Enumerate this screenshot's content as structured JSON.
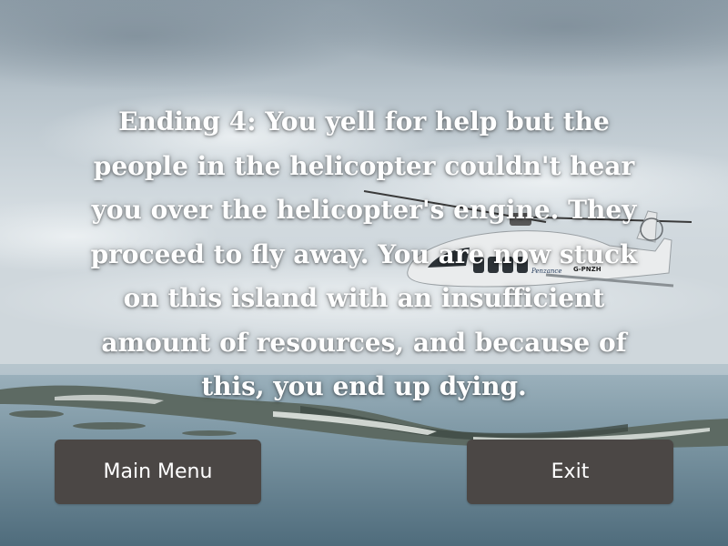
{
  "ending": {
    "text": "Ending 4: You yell for help but the people in the helicopter couldn't hear you over the helicopter's engine. They proceed to fly away. You are now stuck on this island with an insufficient amount of resources, and because of this, you end up dying."
  },
  "helicopter": {
    "livery_text": "Penzance",
    "registration": "G-PNZH"
  },
  "buttons": {
    "main_menu_label": "Main Menu",
    "exit_label": "Exit"
  },
  "colors": {
    "button_bg": "#4b4745",
    "text": "#ffffff"
  }
}
